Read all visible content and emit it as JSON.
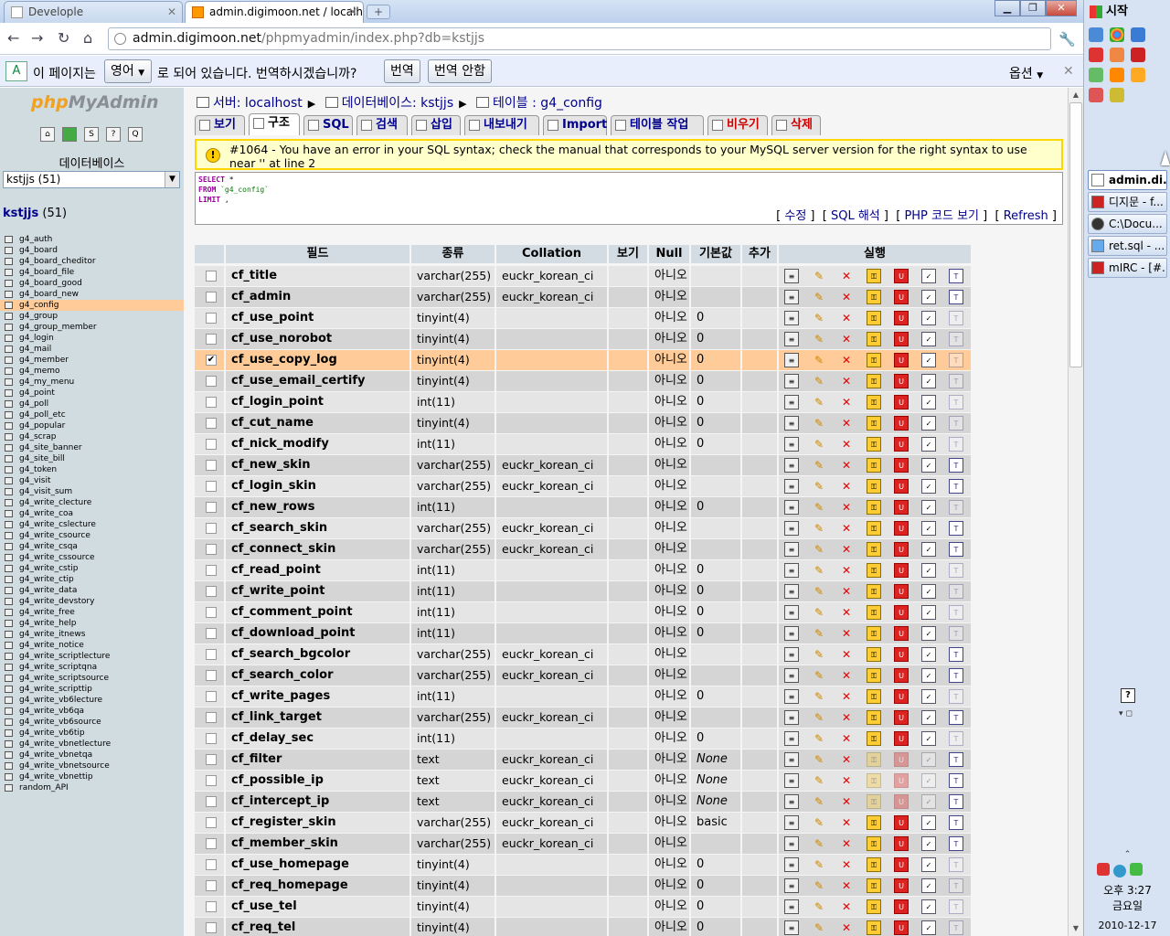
{
  "browser": {
    "tabs": [
      {
        "title": "Develople"
      },
      {
        "title": "admin.digimoon.net / localh..."
      }
    ],
    "url_domain": "admin.digimoon.net",
    "url_path": "/phpmyadmin/index.php?db=kstjjs"
  },
  "translate_bar": {
    "prefix": "이 페이지는",
    "language": "영어",
    "suffix": "로 되어 있습니다. 번역하시겠습니까?",
    "translate_label": "번역",
    "no_translate_label": "번역 안함",
    "options_label": "옵션"
  },
  "sidebar": {
    "logo_part1": "php",
    "logo_part2": "MyAdmin",
    "db_label": "데이터베이스",
    "db_select_value": "kstjjs (51)",
    "db_name": "kstjjs",
    "db_count": "(51)",
    "tables": [
      "g4_auth",
      "g4_board",
      "g4_board_cheditor",
      "g4_board_file",
      "g4_board_good",
      "g4_board_new",
      "g4_config",
      "g4_group",
      "g4_group_member",
      "g4_login",
      "g4_mail",
      "g4_member",
      "g4_memo",
      "g4_my_menu",
      "g4_point",
      "g4_poll",
      "g4_poll_etc",
      "g4_popular",
      "g4_scrap",
      "g4_site_banner",
      "g4_site_bill",
      "g4_token",
      "g4_visit",
      "g4_visit_sum",
      "g4_write_clecture",
      "g4_write_coa",
      "g4_write_cslecture",
      "g4_write_csource",
      "g4_write_csqa",
      "g4_write_cssource",
      "g4_write_cstip",
      "g4_write_ctip",
      "g4_write_data",
      "g4_write_devstory",
      "g4_write_free",
      "g4_write_help",
      "g4_write_itnews",
      "g4_write_notice",
      "g4_write_scriptlecture",
      "g4_write_scriptqna",
      "g4_write_scriptsource",
      "g4_write_scripttip",
      "g4_write_vb6lecture",
      "g4_write_vb6qa",
      "g4_write_vb6source",
      "g4_write_vb6tip",
      "g4_write_vbnetlecture",
      "g4_write_vbnetqa",
      "g4_write_vbnetsource",
      "g4_write_vbnettip",
      "random_API"
    ],
    "selected_table": "g4_config"
  },
  "breadcrumb": {
    "server": "서버: localhost",
    "database": "데이터베이스: kstjjs",
    "table": "테이블 : g4_config"
  },
  "tabs": [
    "보기",
    "구조",
    "SQL",
    "검색",
    "삽입",
    "내보내기",
    "Import",
    "테이블 작업",
    "비우기",
    "삭제"
  ],
  "error": {
    "message": "#1064 - You have an error in your SQL syntax; check the manual that corresponds to your MySQL server version for the right syntax to use near '' at line 2"
  },
  "sql": {
    "line1_kw": "SELECT",
    "line1_rest": " *",
    "line2_kw": "FROM",
    "line2_rest": " `g4_config`",
    "line3_kw": "LIMIT",
    "line3_rest": " ,"
  },
  "sql_links": {
    "edit": "수정",
    "explain": "SQL 해석",
    "php": "PHP 코드 보기",
    "refresh": "Refresh"
  },
  "table": {
    "headers": [
      "필드",
      "종류",
      "Collation",
      "보기",
      "Null",
      "기본값",
      "추가",
      "실행"
    ],
    "rows": [
      {
        "field": "cf_title",
        "type": "varchar(255)",
        "collation": "euckr_korean_ci",
        "null": "아니오",
        "default": ""
      },
      {
        "field": "cf_admin",
        "type": "varchar(255)",
        "collation": "euckr_korean_ci",
        "null": "아니오",
        "default": ""
      },
      {
        "field": "cf_use_point",
        "type": "tinyint(4)",
        "collation": "",
        "null": "아니오",
        "default": "0"
      },
      {
        "field": "cf_use_norobot",
        "type": "tinyint(4)",
        "collation": "",
        "null": "아니오",
        "default": "0"
      },
      {
        "field": "cf_use_copy_log",
        "type": "tinyint(4)",
        "collation": "",
        "null": "아니오",
        "default": "0"
      },
      {
        "field": "cf_use_email_certify",
        "type": "tinyint(4)",
        "collation": "",
        "null": "아니오",
        "default": "0"
      },
      {
        "field": "cf_login_point",
        "type": "int(11)",
        "collation": "",
        "null": "아니오",
        "default": "0"
      },
      {
        "field": "cf_cut_name",
        "type": "tinyint(4)",
        "collation": "",
        "null": "아니오",
        "default": "0"
      },
      {
        "field": "cf_nick_modify",
        "type": "int(11)",
        "collation": "",
        "null": "아니오",
        "default": "0"
      },
      {
        "field": "cf_new_skin",
        "type": "varchar(255)",
        "collation": "euckr_korean_ci",
        "null": "아니오",
        "default": ""
      },
      {
        "field": "cf_login_skin",
        "type": "varchar(255)",
        "collation": "euckr_korean_ci",
        "null": "아니오",
        "default": ""
      },
      {
        "field": "cf_new_rows",
        "type": "int(11)",
        "collation": "",
        "null": "아니오",
        "default": "0"
      },
      {
        "field": "cf_search_skin",
        "type": "varchar(255)",
        "collation": "euckr_korean_ci",
        "null": "아니오",
        "default": ""
      },
      {
        "field": "cf_connect_skin",
        "type": "varchar(255)",
        "collation": "euckr_korean_ci",
        "null": "아니오",
        "default": ""
      },
      {
        "field": "cf_read_point",
        "type": "int(11)",
        "collation": "",
        "null": "아니오",
        "default": "0"
      },
      {
        "field": "cf_write_point",
        "type": "int(11)",
        "collation": "",
        "null": "아니오",
        "default": "0"
      },
      {
        "field": "cf_comment_point",
        "type": "int(11)",
        "collation": "",
        "null": "아니오",
        "default": "0"
      },
      {
        "field": "cf_download_point",
        "type": "int(11)",
        "collation": "",
        "null": "아니오",
        "default": "0"
      },
      {
        "field": "cf_search_bgcolor",
        "type": "varchar(255)",
        "collation": "euckr_korean_ci",
        "null": "아니오",
        "default": ""
      },
      {
        "field": "cf_search_color",
        "type": "varchar(255)",
        "collation": "euckr_korean_ci",
        "null": "아니오",
        "default": ""
      },
      {
        "field": "cf_write_pages",
        "type": "int(11)",
        "collation": "",
        "null": "아니오",
        "default": "0"
      },
      {
        "field": "cf_link_target",
        "type": "varchar(255)",
        "collation": "euckr_korean_ci",
        "null": "아니오",
        "default": ""
      },
      {
        "field": "cf_delay_sec",
        "type": "int(11)",
        "collation": "",
        "null": "아니오",
        "default": "0"
      },
      {
        "field": "cf_filter",
        "type": "text",
        "collation": "euckr_korean_ci",
        "null": "아니오",
        "default": "None"
      },
      {
        "field": "cf_possible_ip",
        "type": "text",
        "collation": "euckr_korean_ci",
        "null": "아니오",
        "default": "None"
      },
      {
        "field": "cf_intercept_ip",
        "type": "text",
        "collation": "euckr_korean_ci",
        "null": "아니오",
        "default": "None"
      },
      {
        "field": "cf_register_skin",
        "type": "varchar(255)",
        "collation": "euckr_korean_ci",
        "null": "아니오",
        "default": "basic"
      },
      {
        "field": "cf_member_skin",
        "type": "varchar(255)",
        "collation": "euckr_korean_ci",
        "null": "아니오",
        "default": ""
      },
      {
        "field": "cf_use_homepage",
        "type": "tinyint(4)",
        "collation": "",
        "null": "아니오",
        "default": "0"
      },
      {
        "field": "cf_req_homepage",
        "type": "tinyint(4)",
        "collation": "",
        "null": "아니오",
        "default": "0"
      },
      {
        "field": "cf_use_tel",
        "type": "tinyint(4)",
        "collation": "",
        "null": "아니오",
        "default": "0"
      },
      {
        "field": "cf_req_tel",
        "type": "tinyint(4)",
        "collation": "",
        "null": "아니오",
        "default": "0"
      }
    ],
    "highlighted_field": "cf_use_copy_log",
    "checked_field": "cf_use_copy_log"
  },
  "taskbar": {
    "start_label": "시작",
    "tasks": [
      "admin.di...",
      "디지문 - f...",
      "C:\\Docu...",
      "ret.sql - ...",
      "mIRC - [#..."
    ],
    "clock_time": "오후 3:27",
    "clock_day": "금요일",
    "clock_date": "2010-12-17"
  }
}
